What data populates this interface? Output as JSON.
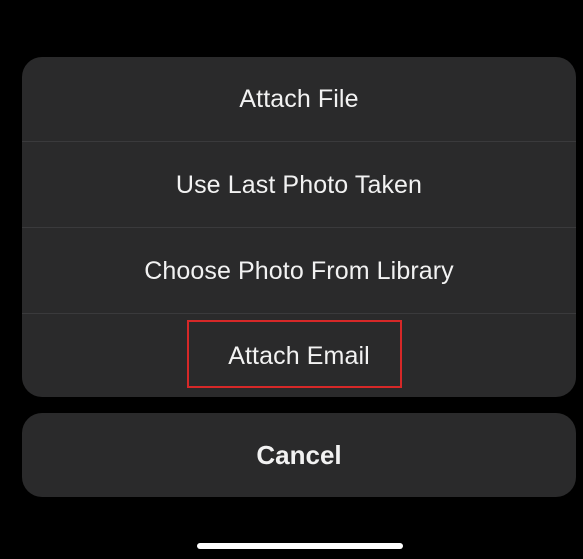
{
  "action_sheet": {
    "items": [
      {
        "label": "Attach File"
      },
      {
        "label": "Use Last Photo Taken"
      },
      {
        "label": "Choose Photo From Library"
      },
      {
        "label": "Attach Email"
      }
    ]
  },
  "cancel": {
    "label": "Cancel"
  },
  "colors": {
    "background": "#000000",
    "sheet_background": "#2a2a2b",
    "text": "#f2f2f2",
    "separator": "#3a3a3c",
    "highlight": "#d62828",
    "home_indicator": "#ffffff"
  }
}
